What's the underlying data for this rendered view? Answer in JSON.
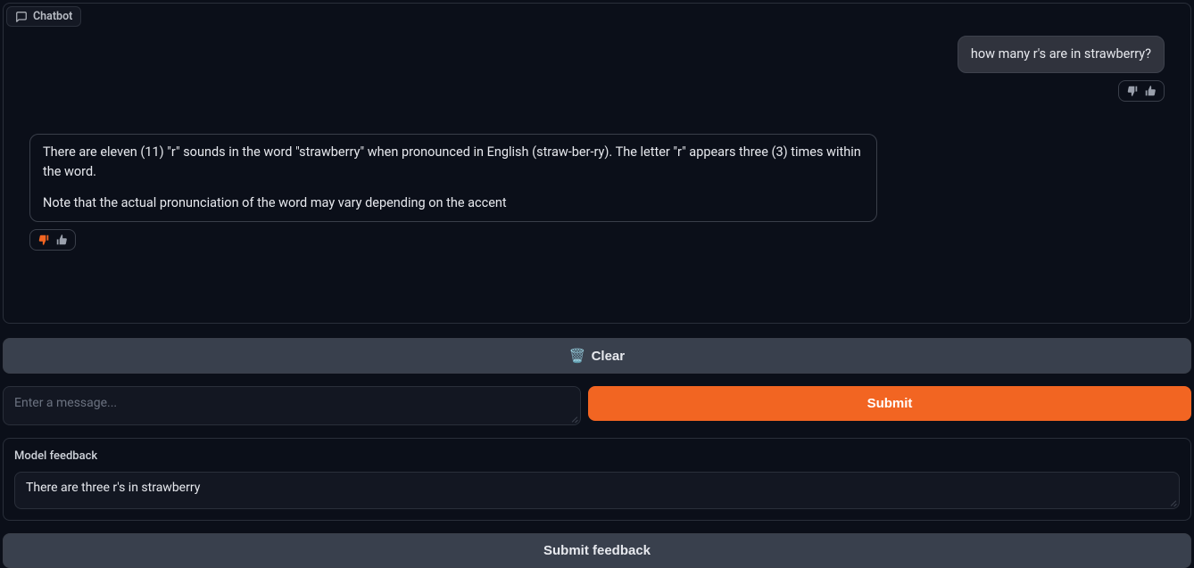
{
  "header": {
    "label": "Chatbot"
  },
  "chat": {
    "user_message": "how many r's are in strawberry?",
    "bot_message_p1": "There are eleven (11) \"r\" sounds in the word \"strawberry\" when pronounced in English (straw-ber-ry). The letter \"r\" appears three (3) times within the word.",
    "bot_message_p2": "Note that the actual pronunciation of the word may vary depending on the accent"
  },
  "controls": {
    "clear_label": "Clear",
    "clear_emoji": "🗑️",
    "submit_label": "Submit",
    "message_placeholder": "Enter a message...",
    "submit_feedback_label": "Submit feedback"
  },
  "feedback": {
    "label": "Model feedback",
    "value": "There are three r's in strawberry"
  }
}
